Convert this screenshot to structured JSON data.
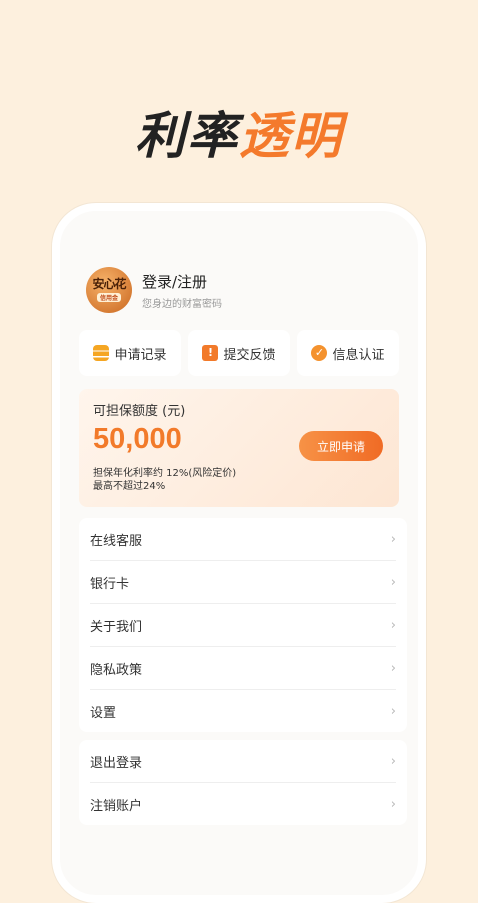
{
  "headline": {
    "part1": "利率",
    "part2": "透明"
  },
  "profile": {
    "logo_text": "安心花",
    "logo_sub": "信用金",
    "login_label": "登录/注册",
    "slogan": "您身边的财富密码"
  },
  "quick_actions": [
    {
      "label": "申请记录",
      "icon": "coins-icon"
    },
    {
      "label": "提交反馈",
      "icon": "feedback-icon",
      "glyph": "!"
    },
    {
      "label": "信息认证",
      "icon": "verify-check-icon",
      "glyph": "✓"
    }
  ],
  "credit": {
    "label": "可担保额度 (元)",
    "amount": "50,000",
    "apply_label": "立即申请",
    "rate_line1": "担保年化利率约 12%(风险定价)",
    "rate_line2": "最高不超过24%"
  },
  "menu": [
    {
      "label": "在线客服"
    },
    {
      "label": "银行卡"
    },
    {
      "label": "关于我们"
    },
    {
      "label": "隐私政策"
    },
    {
      "label": "设置"
    }
  ],
  "menu2": [
    {
      "label": "退出登录"
    },
    {
      "label": "注销账户"
    }
  ],
  "chevron": "›",
  "colors": {
    "accent": "#f27a2a",
    "background": "#fdf0de"
  }
}
